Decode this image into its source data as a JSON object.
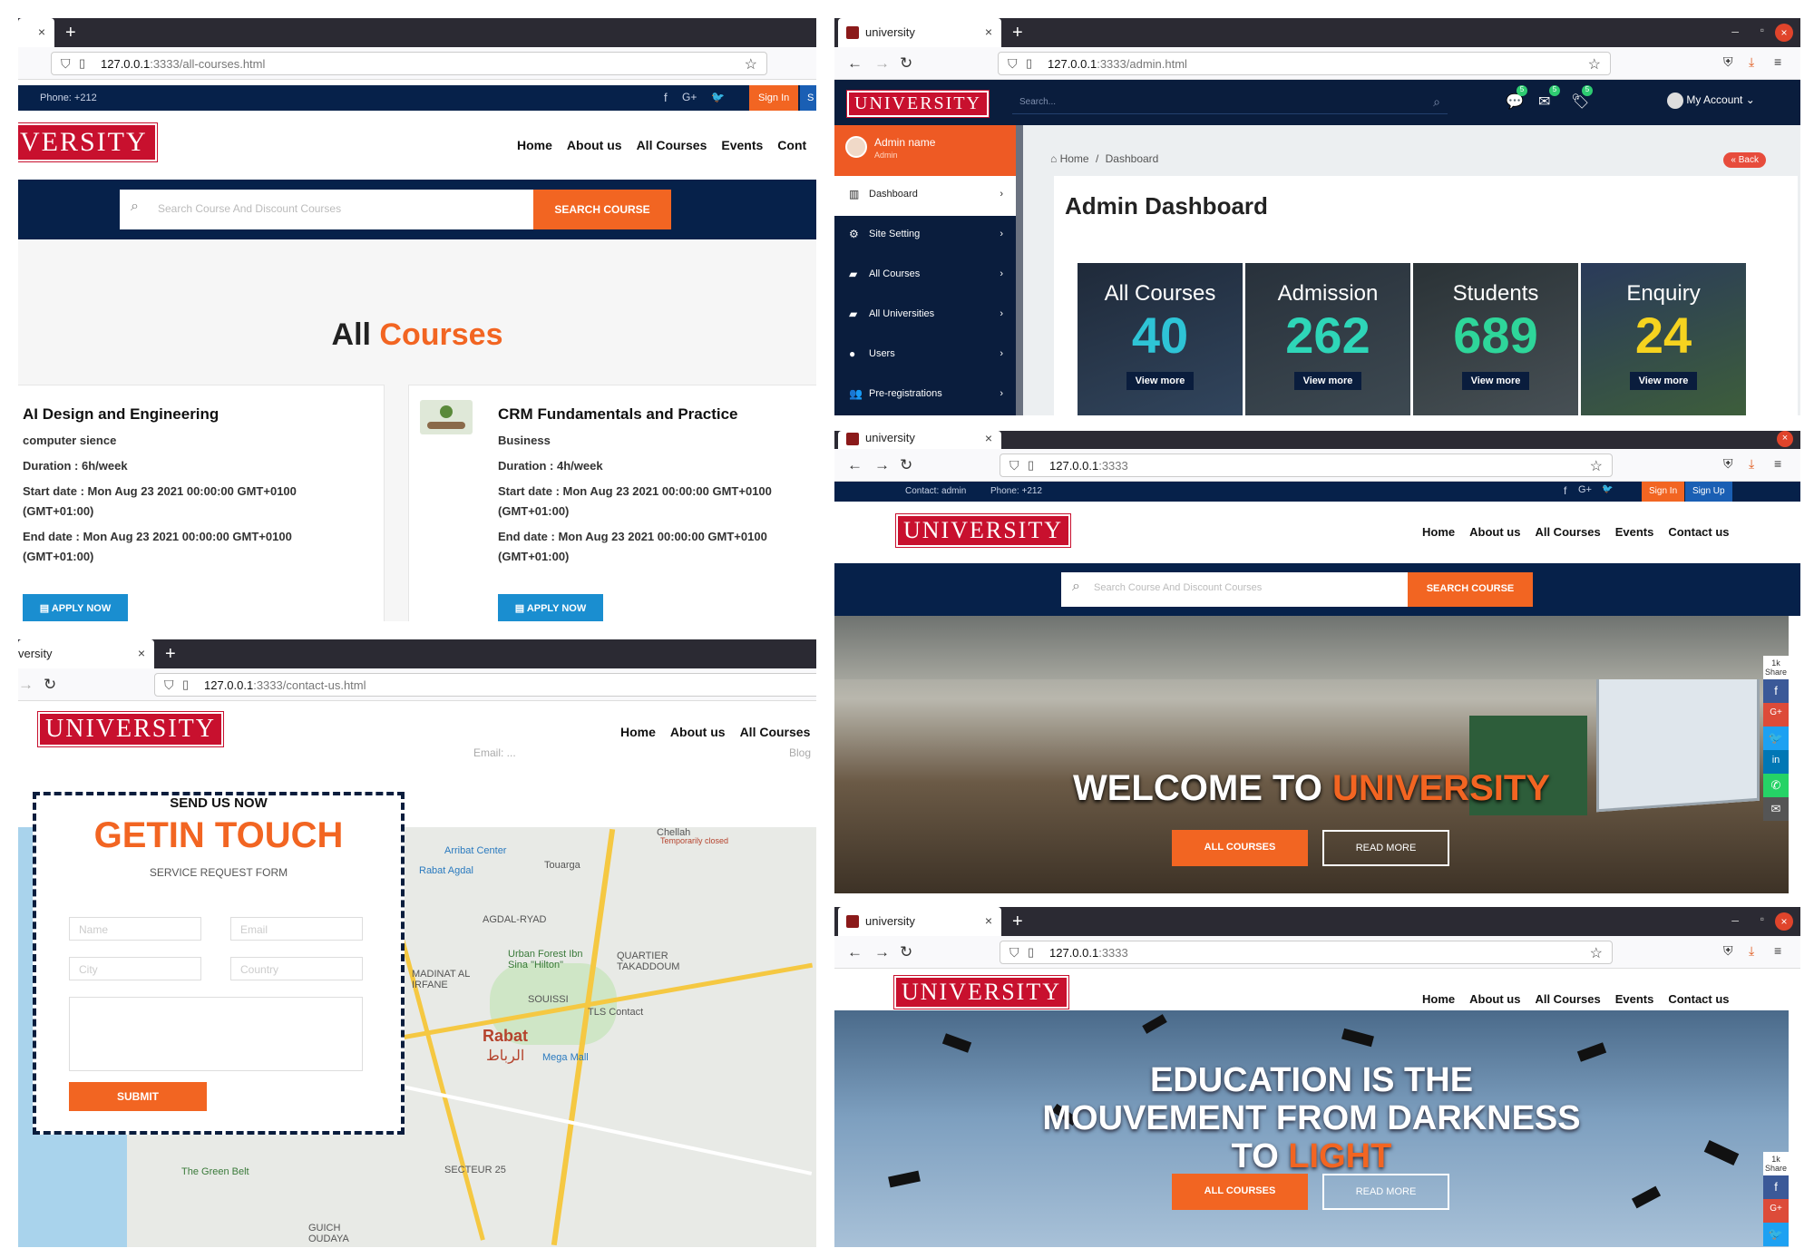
{
  "courses_window": {
    "tab": {
      "close": "×"
    },
    "url_host": "127.0.0.1",
    "url_path": ":3333/all-courses.html",
    "phone": "Phone: +212",
    "signin": "Sign In",
    "signup_partial": "S",
    "logo_partial": "VERSITY",
    "menu": [
      "Home",
      "About us",
      "All Courses",
      "Events",
      "Cont"
    ],
    "search_placeholder": "Search Course And Discount Courses",
    "search_button": "SEARCH COURSE",
    "heading_a": "All",
    "heading_b": "Courses",
    "courses": [
      {
        "title": "AI Design and Engineering",
        "category": "computer sience",
        "duration": "Duration : 6h/week",
        "start": "Start date : Mon Aug 23 2021 00:00:00 GMT+0100",
        "start2": "(GMT+01:00)",
        "end": "End date : Mon Aug 23 2021 00:00:00 GMT+0100",
        "end2": "(GMT+01:00)",
        "button": "APPLY NOW"
      },
      {
        "title": "CRM Fundamentals and Practice",
        "category": "Business",
        "duration": "Duration : 4h/week",
        "start": "Start date : Mon Aug 23 2021 00:00:00 GMT+0100",
        "start2": "(GMT+01:00)",
        "end": "End date : Mon Aug 23 2021 00:00:00 GMT+0100",
        "end2": "(GMT+01:00)",
        "button": "APPLY NOW"
      }
    ]
  },
  "admin_window": {
    "tab_title": "university",
    "url_host": "127.0.0.1",
    "url_path": ":3333/admin.html",
    "logo": "UNIVERSITY",
    "search_placeholder": "Search...",
    "badges": [
      "5",
      "5",
      "5"
    ],
    "account": "My Account",
    "admin_name": "Admin name",
    "admin_role": "Admin",
    "breadcrumb_home": "Home",
    "breadcrumb_sep": "/",
    "breadcrumb_current": "Dashboard",
    "back": "Back",
    "title": "Admin Dashboard",
    "sidebar": [
      {
        "label": "Dashboard",
        "icon": "bar-chart-icon"
      },
      {
        "label": "Site Setting",
        "icon": "gears-icon"
      },
      {
        "label": "All Courses",
        "icon": "book-icon"
      },
      {
        "label": "All Universities",
        "icon": "book-icon"
      },
      {
        "label": "Users",
        "icon": "user-icon"
      },
      {
        "label": "Pre-registrations",
        "icon": "users-icon"
      }
    ],
    "stats": [
      {
        "label": "All Courses",
        "value": "40",
        "link": "View more",
        "color": "#2ec4d6"
      },
      {
        "label": "Admission",
        "value": "262",
        "link": "View more",
        "color": "#2ed6b8"
      },
      {
        "label": "Students",
        "value": "689",
        "link": "View more",
        "color": "#2ed69a"
      },
      {
        "label": "Enquiry",
        "value": "24",
        "link": "View more",
        "color": "#f6d31f"
      }
    ]
  },
  "home_window": {
    "tab_title": "university",
    "url_host": "127.0.0.1",
    "url_path": ":3333",
    "contact": "Contact: admin",
    "phone": "Phone: +212",
    "signin": "Sign In",
    "signup": "Sign Up",
    "logo": "UNIVERSITY",
    "menu": [
      "Home",
      "About us",
      "All Courses",
      "Events",
      "Contact us"
    ],
    "search_placeholder": "Search Course And Discount Courses",
    "search_button": "SEARCH COURSE",
    "hero_a": "WELCOME TO",
    "hero_b": "UNIVERSITY",
    "btn_courses": "ALL COURSES",
    "btn_read": "READ MORE",
    "share_count": "1k",
    "share_label": "Share"
  },
  "contact_window": {
    "tab_title": "versity",
    "url_host": "127.0.0.1",
    "url_path": ":3333/contact-us.html",
    "logo": "UNIVERSITY",
    "menu": [
      "Home",
      "About us",
      "All Courses"
    ],
    "email_partial": "Email: ...",
    "blog_partial": "Blog",
    "form_kicker": "SEND US NOW",
    "form_title": "GETIN TOUCH",
    "form_subtitle": "SERVICE REQUEST FORM",
    "fields": {
      "name": "Name",
      "email": "Email",
      "city": "City",
      "country": "Country"
    },
    "submit": "SUBMIT",
    "map_labels": [
      "Arribat Center",
      "Touarga",
      "Rabat Agdal",
      "AGDAL-RYAD",
      "Urban Forest Ibn Sina \"Hilton\"",
      "QUARTIER TAKADDOUM",
      "MADINAT AL IRFANE",
      "SOUISSI",
      "TLS Contact",
      "Rabat",
      "الرباط",
      "Mega Mall",
      "SECTEUR 25",
      "The Green Belt",
      "GUICH OUDAYA",
      "Chellah",
      "Temporarily closed"
    ]
  },
  "education_window": {
    "tab_title": "university",
    "url_host": "127.0.0.1",
    "url_path": ":3333",
    "logo": "UNIVERSITY",
    "menu": [
      "Home",
      "About us",
      "All Courses",
      "Events",
      "Contact us"
    ],
    "hero_line1": "EDUCATION IS THE",
    "hero_line2": "MOUVEMENT FROM DARKNESS",
    "hero_line3a": "TO",
    "hero_line3b": "LIGHT",
    "btn_courses": "ALL COURSES",
    "btn_read": "READ MORE",
    "share_count": "1k",
    "share_label": "Share"
  }
}
